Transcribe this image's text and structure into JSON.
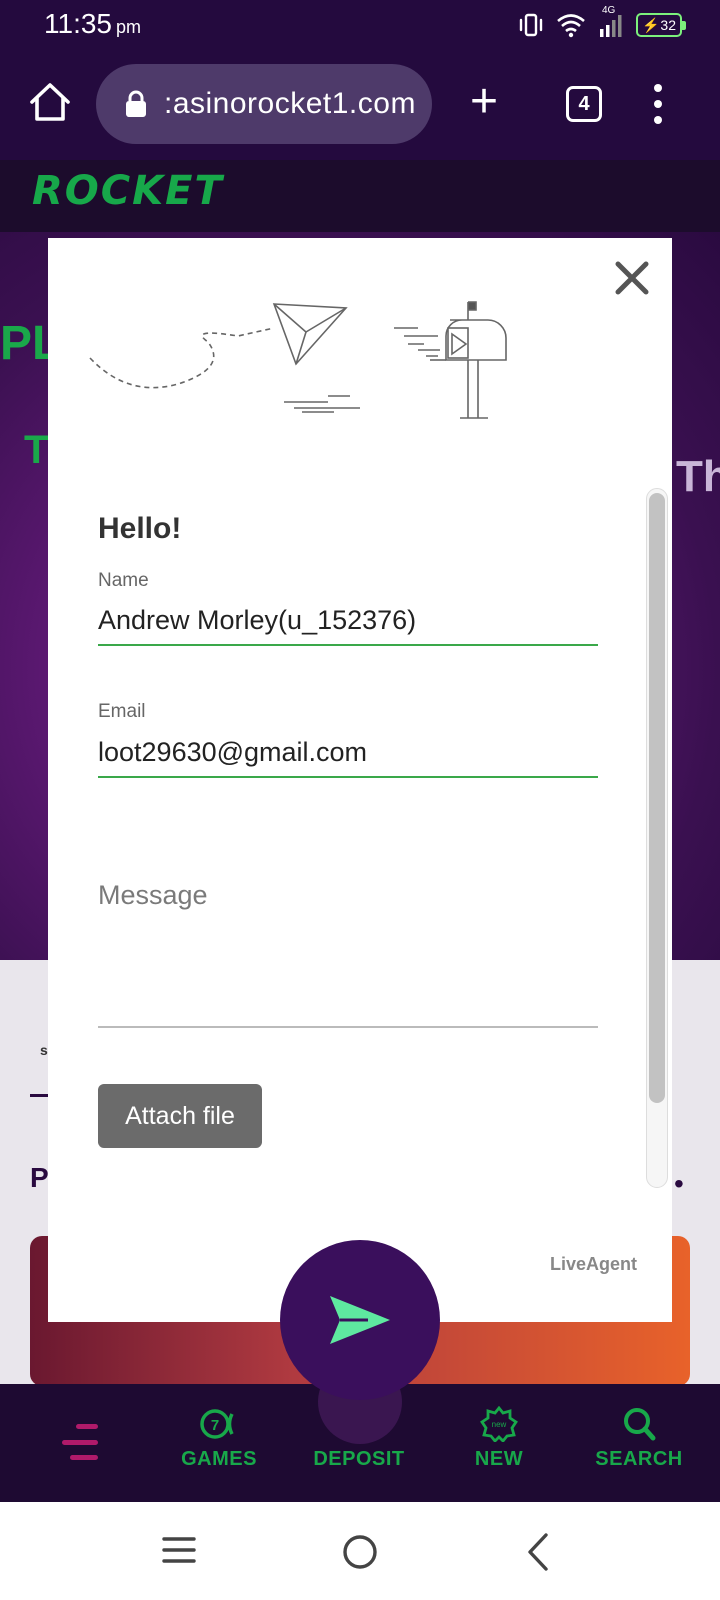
{
  "status_bar": {
    "time": "11:35",
    "ampm": "pm",
    "network": "4G",
    "battery": "32"
  },
  "browser": {
    "url": ":asinorocket1.com",
    "tab_count": "4"
  },
  "site": {
    "logo": "ROCKET",
    "hero_text_1": "PLA",
    "hero_text_2": "T",
    "hero_text_3": "Th",
    "content_p": "P",
    "content_dot": "•",
    "content_s": "s"
  },
  "form": {
    "greeting": "Hello!",
    "name_label": "Name",
    "name_value": "Andrew Morley(u_152376)",
    "email_label": "Email",
    "email_value": "loot29630@gmail.com",
    "message_placeholder": "Message",
    "attach_label": "Attach file",
    "brand": "LiveAgent"
  },
  "bottom_nav": {
    "games": "GAMES",
    "deposit": "DEPOSIT",
    "new": "NEW",
    "search": "SEARCH",
    "games_badge": "7",
    "new_badge": "new"
  },
  "colors": {
    "brand_green": "#18a84a",
    "purple": "#3a0f5c",
    "send_arrow": "#5ee8a0"
  }
}
